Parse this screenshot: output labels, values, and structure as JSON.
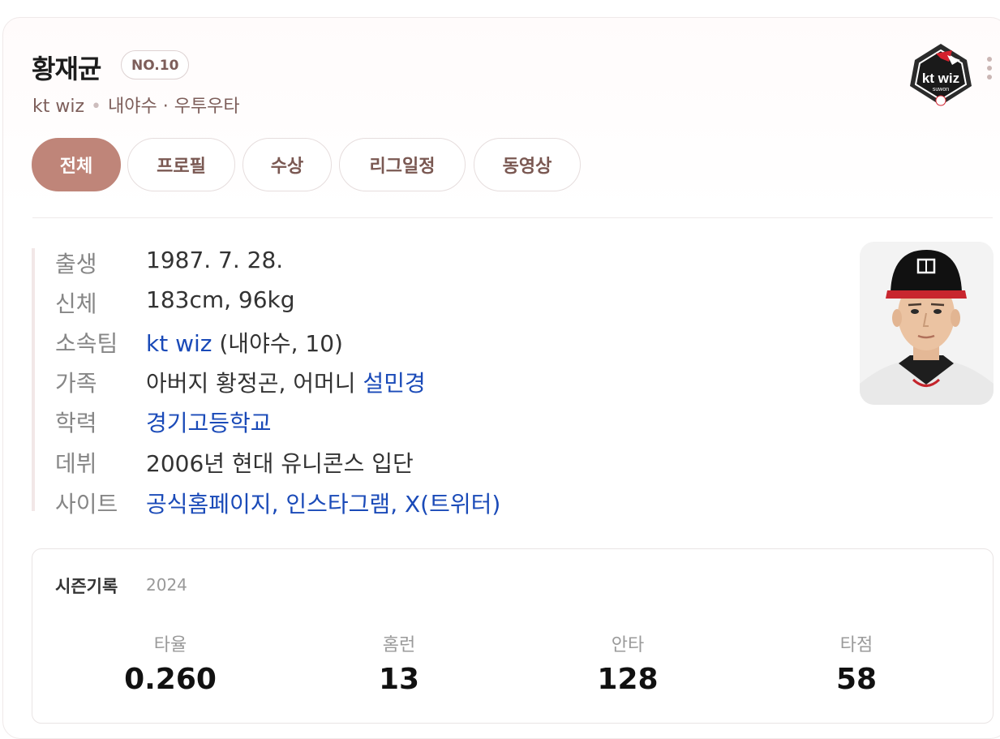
{
  "player": {
    "name": "황재균",
    "number_badge": "NO.10",
    "team": "kt wiz",
    "position": "내야수 · 우투우타"
  },
  "logo": {
    "alt": "kt wiz",
    "text": "kt wiz",
    "sub": "suwon",
    "icon": "team-logo-icon"
  },
  "tabs": [
    {
      "label": "전체",
      "active": true
    },
    {
      "label": "프로필",
      "active": false
    },
    {
      "label": "수상",
      "active": false
    },
    {
      "label": "리그일정",
      "active": false
    },
    {
      "label": "동영상",
      "active": false
    }
  ],
  "profile": {
    "birth": {
      "key": "출생",
      "value": "1987. 7. 28."
    },
    "body": {
      "key": "신체",
      "value": "183cm, 96kg"
    },
    "team": {
      "key": "소속팀",
      "link": "kt wiz",
      "rest": " (내야수, 10)"
    },
    "family": {
      "key": "가족",
      "text": "아버지 황정곤, 어머니 ",
      "link": "설민경"
    },
    "school": {
      "key": "학력",
      "link": "경기고등학교"
    },
    "debut": {
      "key": "데뷔",
      "value": "2006년 현대 유니콘스 입단"
    },
    "site": {
      "key": "사이트",
      "links": [
        "공식홈페이지",
        "인스타그램",
        "X(트위터)"
      ],
      "sep": ", "
    }
  },
  "season": {
    "title": "시즌기록",
    "year": "2024",
    "stats": [
      {
        "label": "타율",
        "value": "0.260"
      },
      {
        "label": "홈런",
        "value": "13"
      },
      {
        "label": "안타",
        "value": "128"
      },
      {
        "label": "타점",
        "value": "58"
      }
    ]
  },
  "colors": {
    "accent": "#bf8579",
    "link": "#1a4ab8",
    "subtext": "#7d5e5a"
  }
}
